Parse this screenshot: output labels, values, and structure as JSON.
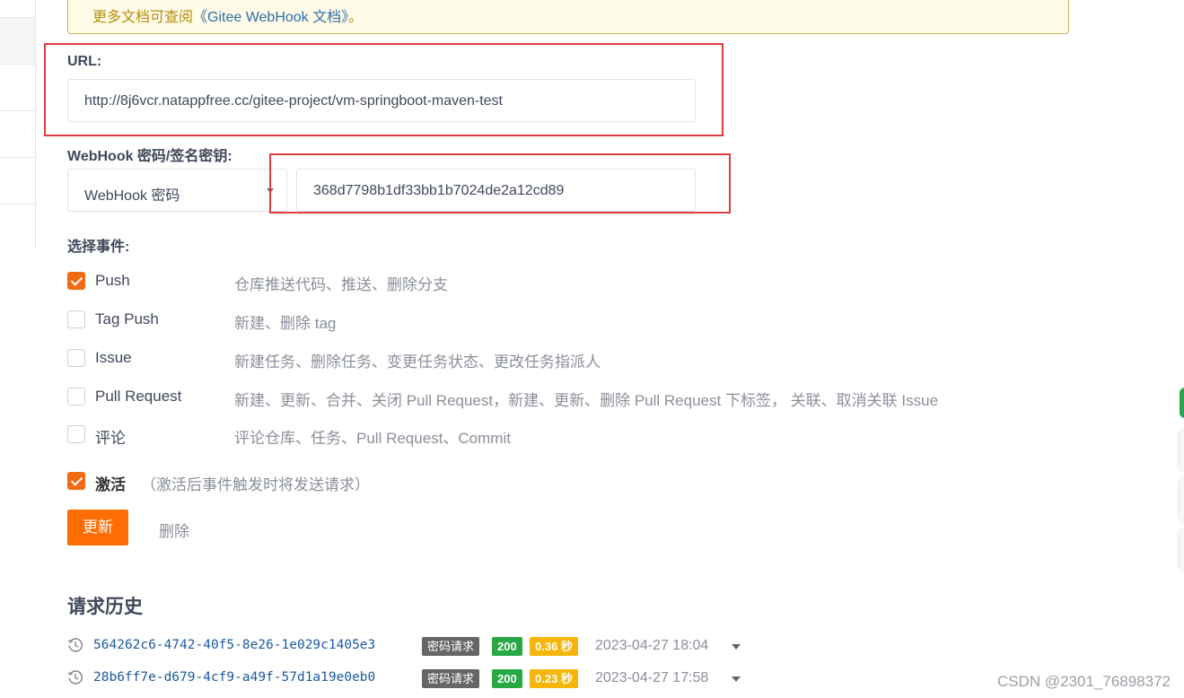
{
  "notice": {
    "prefix": "更多文档可查阅",
    "link": "《Gitee WebHook 文档》",
    "suffix": "。"
  },
  "url": {
    "label": "URL:",
    "value": "http://8j6vcr.natappfree.cc/gitee-project/vm-springboot-maven-test"
  },
  "secret": {
    "label": "WebHook 密码/签名密钥:",
    "select_value": "WebHook 密码",
    "value": "368d7798b1df33bb1b7024de2a12cd89"
  },
  "events": {
    "label": "选择事件:",
    "items": [
      {
        "name": "Push",
        "desc": "仓库推送代码、推送、删除分支",
        "checked": true
      },
      {
        "name": "Tag Push",
        "desc": "新建、删除 tag",
        "checked": false
      },
      {
        "name": "Issue",
        "desc": "新建任务、删除任务、变更任务状态、更改任务指派人",
        "checked": false
      },
      {
        "name": "Pull Request",
        "desc": "新建、更新、合并、关闭 Pull Request，新建、更新、删除 Pull Request 下标签， 关联、取消关联 Issue",
        "checked": false
      },
      {
        "name": "评论",
        "desc": "评论仓库、任务、Pull Request、Commit",
        "checked": false
      }
    ]
  },
  "activate": {
    "label": "激活",
    "hint": "（激活后事件触发时将发送请求）",
    "checked": true
  },
  "actions": {
    "update_label": "更新",
    "delete_label": "删除"
  },
  "history": {
    "title": "请求历史",
    "rows": [
      {
        "id": "564262c6-4742-40f5-8e26-1e029c1405e3",
        "type": "密码请求",
        "status": "200",
        "duration": "0.36 秒",
        "time": "2023-04-27 18:04"
      },
      {
        "id": "28b6ff7e-d679-4cf9-a49f-57d1a19e0eb0",
        "type": "密码请求",
        "status": "200",
        "duration": "0.23 秒",
        "time": "2023-04-27 17:58"
      }
    ]
  },
  "watermark": "CSDN @2301_76898372",
  "colors": {
    "accent": "#fd6d04",
    "highlight_box": "#e03c3c",
    "status_ok": "#28a745",
    "duration_badge": "#f5b50a"
  }
}
